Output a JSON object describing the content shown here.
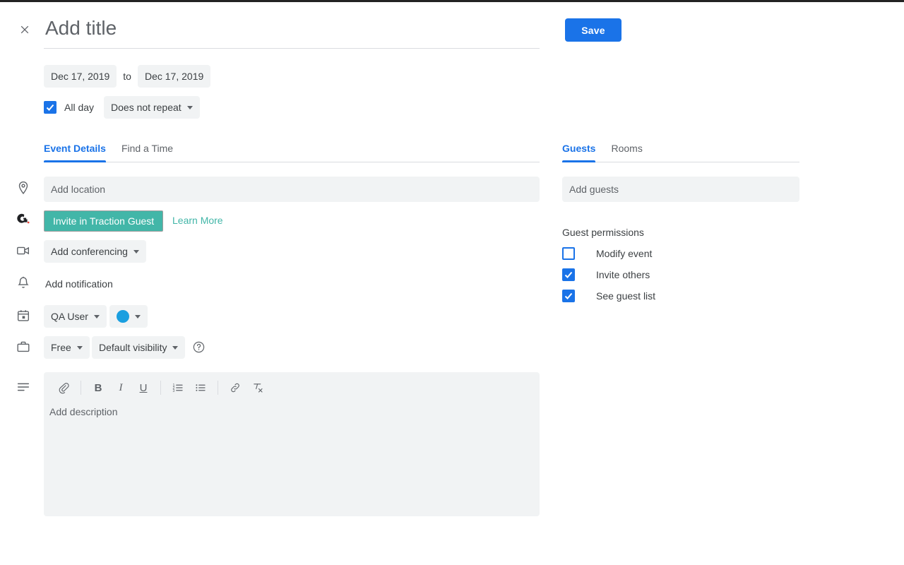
{
  "window": {
    "title": "Add title"
  },
  "header": {
    "close_icon": "close-icon",
    "title_placeholder": "Add title",
    "title_value": "",
    "save_label": "Save"
  },
  "schedule": {
    "start_date": "Dec 17, 2019",
    "to_label": "to",
    "end_date": "Dec 17, 2019",
    "all_day_label": "All day",
    "all_day_checked": true,
    "repeat_label": "Does not repeat"
  },
  "left_tabs": [
    {
      "label": "Event Details",
      "active": true
    },
    {
      "label": "Find a Time",
      "active": false
    }
  ],
  "right_tabs": [
    {
      "label": "Guests",
      "active": true
    },
    {
      "label": "Rooms",
      "active": false
    }
  ],
  "details": {
    "location_placeholder": "Add location",
    "location_value": "",
    "traction_button": "Invite in Traction Guest",
    "learn_more": "Learn More",
    "conferencing_label": "Add conferencing",
    "notification_label": "Add notification",
    "calendar_owner": "QA User",
    "event_color": "#1a9fe0",
    "availability_label": "Free",
    "visibility_label": "Default visibility",
    "help_icon": "help-circle-icon",
    "description_placeholder": "Add description",
    "description_value": ""
  },
  "description_toolbar": [
    {
      "name": "attach-icon",
      "glyph": "attach"
    },
    {
      "name": "bold-icon",
      "glyph": "B"
    },
    {
      "name": "italic-icon",
      "glyph": "I"
    },
    {
      "name": "underline-icon",
      "glyph": "U"
    },
    {
      "name": "numbered-list-icon",
      "glyph": "ol"
    },
    {
      "name": "bulleted-list-icon",
      "glyph": "ul"
    },
    {
      "name": "link-icon",
      "glyph": "link"
    },
    {
      "name": "clear-formatting-icon",
      "glyph": "clear"
    }
  ],
  "guests": {
    "input_placeholder": "Add guests",
    "input_value": "",
    "permissions_title": "Guest permissions",
    "permissions": [
      {
        "label": "Modify event",
        "checked": false
      },
      {
        "label": "Invite others",
        "checked": true
      },
      {
        "label": "See guest list",
        "checked": true
      }
    ]
  },
  "colors": {
    "accent_blue": "#1a73e8",
    "teal": "#42b6a8",
    "chip_gray": "#f1f3f4",
    "text_gray": "#5f6368",
    "topbar": "#232323"
  }
}
